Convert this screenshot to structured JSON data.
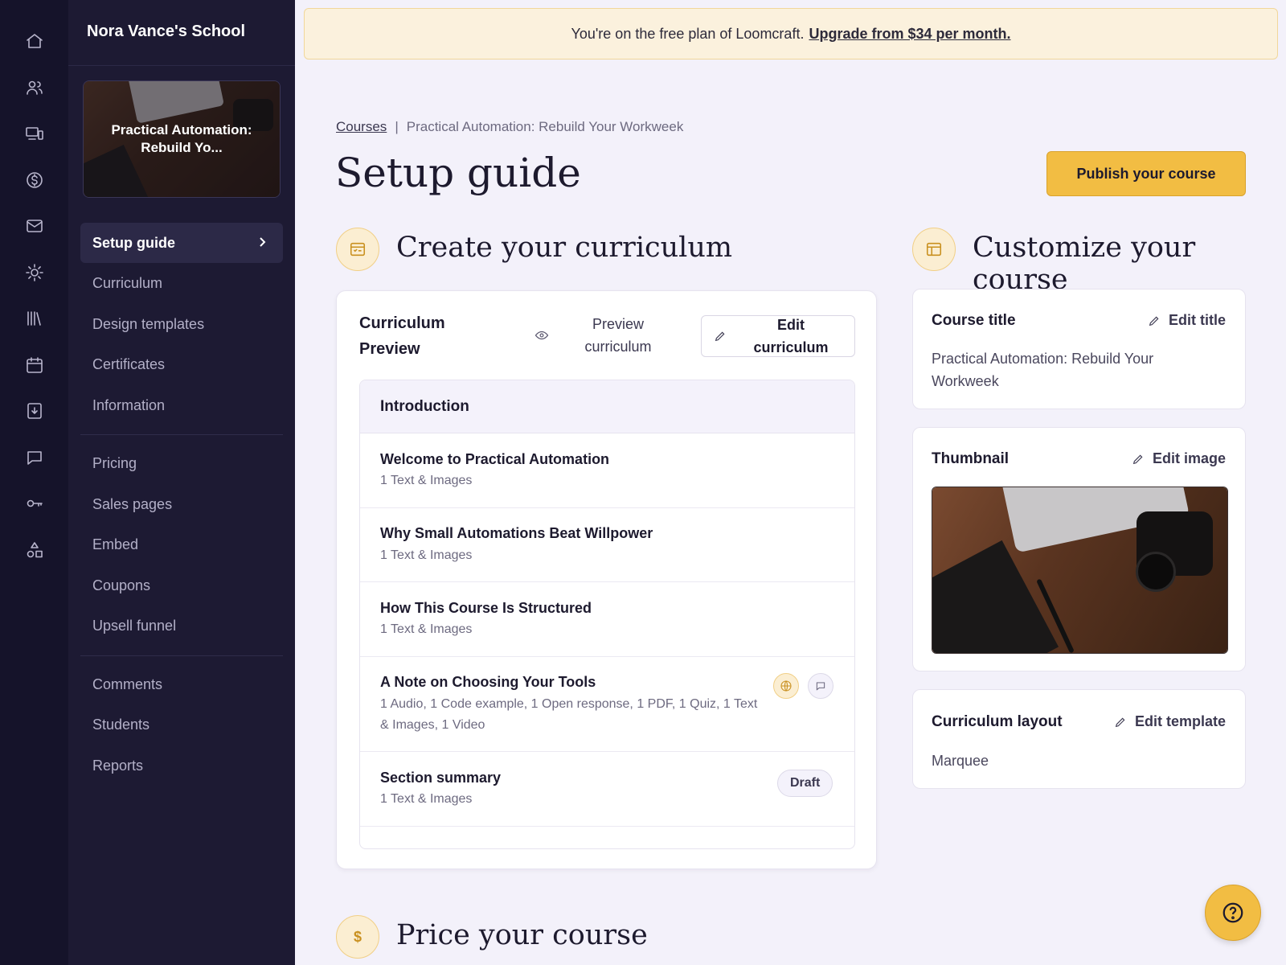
{
  "rail": {
    "icons": [
      "home-icon",
      "users-icon",
      "devices-icon",
      "dollar-icon",
      "mail-icon",
      "sun-icon",
      "library-icon",
      "calendar-icon",
      "download-icon",
      "chat-icon",
      "key-icon",
      "shapes-icon"
    ]
  },
  "sidebar": {
    "school_name": "Nora Vance's School",
    "course_card_title": "Practical Automation: Rebuild Yo...",
    "items": [
      {
        "label": "Setup guide",
        "active": true
      },
      {
        "label": "Curriculum"
      },
      {
        "label": "Design templates"
      },
      {
        "label": "Certificates"
      },
      {
        "label": "Information"
      },
      {
        "label": "Pricing"
      },
      {
        "label": "Sales pages"
      },
      {
        "label": "Embed"
      },
      {
        "label": "Coupons"
      },
      {
        "label": "Upsell funnel"
      },
      {
        "label": "Comments"
      },
      {
        "label": "Students"
      },
      {
        "label": "Reports"
      }
    ]
  },
  "banner": {
    "text": "You're on the free plan of Loomcraft.",
    "link": "Upgrade from $34 per month."
  },
  "breadcrumb": {
    "root": "Courses",
    "separator": "|",
    "current": "Practical Automation: Rebuild Your Workweek"
  },
  "header": {
    "title": "Setup guide",
    "publish_label": "Publish your course"
  },
  "curriculum_section": {
    "title": "Create your curriculum",
    "card_title": "Curriculum Preview",
    "preview_label": "Preview curriculum",
    "edit_label": "Edit curriculum",
    "section_name": "Introduction",
    "lessons": [
      {
        "title": "Welcome to Practical Automation",
        "meta": "1 Text & Images"
      },
      {
        "title": "Why Small Automations Beat Willpower",
        "meta": "1 Text & Images"
      },
      {
        "title": "How This Course Is Structured",
        "meta": "1 Text & Images"
      },
      {
        "title": "A Note on Choosing Your Tools",
        "meta": "1 Audio, 1 Code example, 1 Open response, 1 PDF, 1 Quiz, 1 Text & Images, 1 Video"
      },
      {
        "title": "Section summary",
        "meta": "1 Text & Images",
        "badge": "Draft"
      }
    ]
  },
  "customize_section": {
    "title": "Customize your course",
    "course_title_label": "Course title",
    "course_title_action": "Edit title",
    "course_title_value": "Practical Automation: Rebuild Your Workweek",
    "thumbnail_label": "Thumbnail",
    "thumbnail_action": "Edit image",
    "layout_label": "Curriculum layout",
    "layout_action": "Edit template",
    "layout_value": "Marquee"
  },
  "price_section": {
    "title": "Price your course",
    "icon_glyph": "$"
  },
  "colors": {
    "accent": "#f2bd43",
    "sidebar": "#1d1a33",
    "rail": "#15132a",
    "page_bg": "#f3f1fa"
  }
}
